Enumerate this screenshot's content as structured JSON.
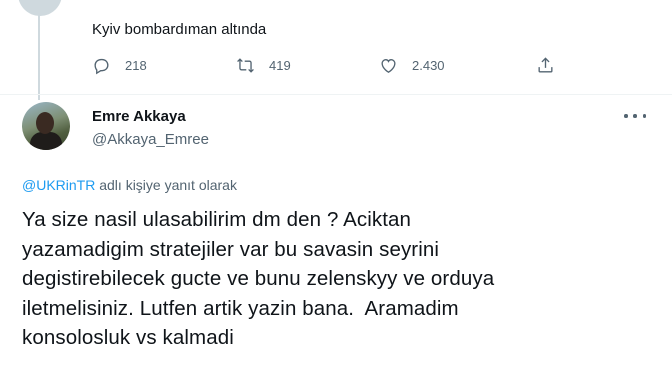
{
  "previous_tweet": {
    "text": "Kyiv bombardıman altında",
    "replies": "218",
    "retweets": "419",
    "likes": "2.430"
  },
  "tweet": {
    "display_name": "Emre Akkaya",
    "handle": "@Akkaya_Emree",
    "reply_mention": "@UKRinTR",
    "reply_suffix": " adlı kişiye yanıt olarak",
    "text": "Ya size nasil ulasabilirim dm den ? Aciktan\nyazamadigim stratejiler var bu savasin seyrini\ndegistirebilecek gucte ve bunu zelenskyy ve orduya\niletmelisiniz. Lutfen artik yazin bana.  Aramadim\nkonsolosluk vs kalmadi"
  },
  "icons": {
    "reply": "reply-icon",
    "retweet": "retweet-icon",
    "like": "heart-icon",
    "share": "share-icon",
    "more": "more-icon"
  },
  "colors": {
    "link": "#1d9bf0",
    "secondary_text": "#536471",
    "primary_text": "#0f1419"
  }
}
